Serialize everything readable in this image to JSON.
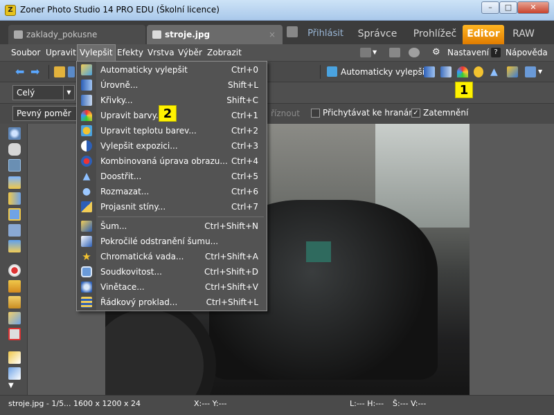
{
  "window": {
    "title": "Zoner Photo Studio 14 PRO EDU (Školní licence)"
  },
  "tabs": {
    "documents": [
      {
        "label": "zaklady_pokusne",
        "active": false
      },
      {
        "label": "stroje.jpg",
        "active": true,
        "close": "×"
      }
    ],
    "modes": {
      "login": "Přihlásit",
      "manager": "Správce",
      "browser": "Prohlížeč",
      "editor": "Editor",
      "raw": "RAW"
    }
  },
  "menubar": {
    "items": [
      "Soubor",
      "Upravit",
      "Vylepšit",
      "Efekty",
      "Vrstva",
      "Výběr",
      "Zobrazit"
    ],
    "settings": "Nastavení",
    "help": "Nápověda"
  },
  "toolbar": {
    "auto_enhance": "Automaticky vylepšit",
    "selection_combo": "Celý",
    "ratio_combo": "Pevný poměr",
    "disabled_button": "říznout",
    "snap_edges": "Přichytávat ke hranám",
    "snap_edges_checked": false,
    "darken": "Zatemnění",
    "darken_checked": true,
    "check_mark": "✓",
    "callout_1": "1",
    "callout_2": "2"
  },
  "dropdown": {
    "items": [
      {
        "label": "Automaticky vylepšit",
        "shortcut": "Ctrl+0"
      },
      {
        "label": "Úrovně...",
        "shortcut": "Shift+L"
      },
      {
        "label": "Křivky...",
        "shortcut": "Shift+C"
      },
      {
        "label": "Upravit barvy...",
        "shortcut": "Ctrl+1"
      },
      {
        "label": "Upravit teplotu barev...",
        "shortcut": "Ctrl+2"
      },
      {
        "label": "Vylepšit expozici...",
        "shortcut": "Ctrl+3"
      },
      {
        "label": "Kombinovaná úprava obrazu...",
        "shortcut": "Ctrl+4"
      },
      {
        "label": "Doostřit...",
        "shortcut": "Ctrl+5"
      },
      {
        "label": "Rozmazat...",
        "shortcut": "Ctrl+6"
      },
      {
        "label": "Projasnit stíny...",
        "shortcut": "Ctrl+7"
      },
      {
        "label": "Šum...",
        "shortcut": "Ctrl+Shift+N"
      },
      {
        "label": "Pokročilé odstranění šumu...",
        "shortcut": ""
      },
      {
        "label": "Chromatická vada...",
        "shortcut": "Ctrl+Shift+A"
      },
      {
        "label": "Soudkovitost...",
        "shortcut": "Ctrl+Shift+D"
      },
      {
        "label": "Vinětace...",
        "shortcut": "Ctrl+Shift+V"
      },
      {
        "label": "Řádkový proklad...",
        "shortcut": "Ctrl+Shift+L"
      }
    ]
  },
  "statusbar": {
    "file_info": "stroje.jpg - 1/5...  1600 x 1200 x 24",
    "xy": "X:---   Y:---",
    "lh": "L:---   H:---",
    "sv": "Š:---   V:---"
  },
  "colors": {
    "accent": "#f39a00",
    "callout": "#fff200"
  }
}
